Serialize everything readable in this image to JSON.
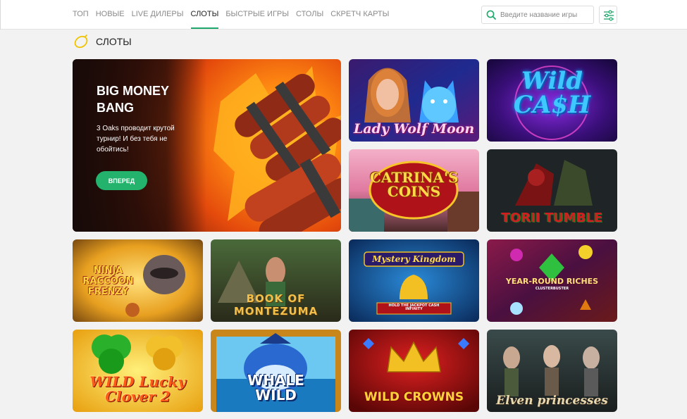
{
  "nav": {
    "items": [
      {
        "label": "ТОП",
        "active": false
      },
      {
        "label": "НОВЫЕ",
        "active": false
      },
      {
        "label": "LIVE ДИЛЕРЫ",
        "active": false
      },
      {
        "label": "СЛОТЫ",
        "active": true
      },
      {
        "label": "БЫСТРЫЕ ИГРЫ",
        "active": false
      },
      {
        "label": "СТОЛЫ",
        "active": false
      },
      {
        "label": "СКРЕТЧ КАРТЫ",
        "active": false
      }
    ]
  },
  "search": {
    "placeholder": "Введите название игры",
    "icon": "search-icon"
  },
  "filter": {
    "icon": "sliders-icon"
  },
  "section": {
    "title": "СЛОТЫ",
    "icon": "lemon-icon"
  },
  "banner": {
    "title": "BIG MONEY BANG",
    "text": "3 Oaks проводит крутой турнир! И без тебя не обойтись!",
    "button": "ВПЕРЕД"
  },
  "games": [
    {
      "id": "lady-wolf-moon",
      "title": "Lady Wolf Moon"
    },
    {
      "id": "wild-cash",
      "title": "Wild CA$H"
    },
    {
      "id": "catrinas-coins",
      "title": "CATRINA'S COINS"
    },
    {
      "id": "torii-tumble",
      "title": "TORII TUMBLE"
    },
    {
      "id": "ninja-raccoon-frenzy",
      "title": "NINJA RACCOON FRENZY"
    },
    {
      "id": "book-of-montezuma",
      "title": "BOOK OF MONTEZUMA"
    },
    {
      "id": "mystery-kingdom",
      "title": "Mystery Kingdom",
      "subtitle": "HOLD THE JACKPOT CASH INFINITY"
    },
    {
      "id": "year-round-riches",
      "title": "YEAR-ROUND RICHES",
      "subtitle": "CLUSTERBUSTER"
    },
    {
      "id": "wild-lucky-clover-2",
      "title": "WILD Lucky Clover 2"
    },
    {
      "id": "whale-wild",
      "title": "WHALE WILD"
    },
    {
      "id": "wild-crowns",
      "title": "WILD CROWNS"
    },
    {
      "id": "elven-princesses",
      "title": "Elven princesses"
    }
  ],
  "colors": {
    "accent": "#1fa86b",
    "button": "#24b36d",
    "page_bg": "#f2f2f2"
  }
}
